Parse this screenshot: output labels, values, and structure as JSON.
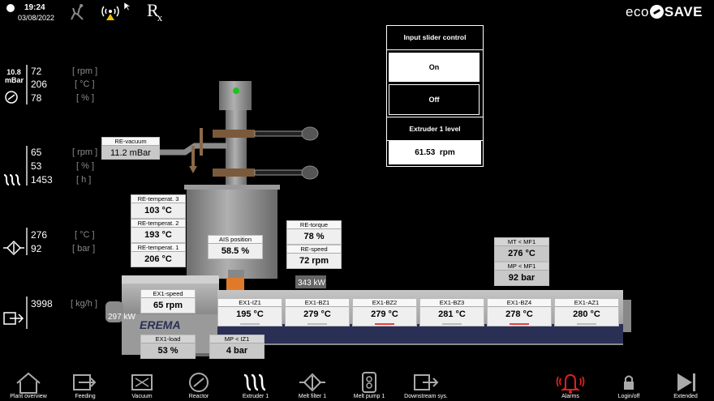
{
  "topbar": {
    "time": "19:24",
    "date": "03/08/2022",
    "brand": "ECO SAVE",
    "rx": "R"
  },
  "left_readouts": {
    "pressure": {
      "value": "10.8",
      "unit": "mBar"
    },
    "group1": [
      {
        "value": "72",
        "unit": "[ rpm ]"
      },
      {
        "value": "206",
        "unit": "[ °C ]"
      },
      {
        "value": "78",
        "unit": "[ % ]"
      }
    ],
    "group2": [
      {
        "value": "65",
        "unit": "[ rpm ]"
      },
      {
        "value": "53",
        "unit": "[ % ]"
      },
      {
        "value": "1453",
        "unit": "[ h ]"
      }
    ],
    "group3": [
      {
        "value": "276",
        "unit": "[ °C ]"
      },
      {
        "value": "92",
        "unit": "[ bar ]"
      }
    ],
    "group4": [
      {
        "value": "3998",
        "unit": "[ kg/h ]"
      }
    ]
  },
  "slider_panel": {
    "title": "Input slider control",
    "on_label": "On",
    "off_label": "Off",
    "level_title": "Extruder 1 level",
    "level_value": "61.53  rpm"
  },
  "process": {
    "re_vacuum": {
      "label": "RE-vacuum",
      "value": "11.2 mBar"
    },
    "re_temp3": {
      "label": "RE-temperat. 3",
      "value": "103 °C"
    },
    "re_temp2": {
      "label": "RE-temperat. 2",
      "value": "193 °C"
    },
    "re_temp1": {
      "label": "RE-temperat. 1",
      "value": "206 °C"
    },
    "ais_position": {
      "label": "AIS position",
      "value": "58.5 %"
    },
    "re_torque": {
      "label": "RE-torque",
      "value": "78 %"
    },
    "re_speed": {
      "label": "RE-speed",
      "value": "72 rpm"
    },
    "power_top": "343 kW",
    "power_left": "297 kW",
    "ex1_speed": {
      "label": "EX1-speed",
      "value": "65 rpm"
    },
    "ex1_load": {
      "label": "EX1-load",
      "value": "53 %"
    },
    "mp_iz1": {
      "label": "MP < IZ1",
      "value": "4 bar"
    },
    "mt_mf1": {
      "label": "MT < MF1",
      "value": "276 °C"
    },
    "mp_mf1": {
      "label": "MP < MF1",
      "value": "92 bar"
    },
    "brand": "EREMA",
    "zones": [
      {
        "label": "EX1-IZ1",
        "value": "195 °C",
        "bar_color": "#bbbbbb"
      },
      {
        "label": "EX1-BZ1",
        "value": "279 °C",
        "bar_color": "#bbbbbb"
      },
      {
        "label": "EX1-BZ2",
        "value": "279 °C",
        "bar_color": "#e04040"
      },
      {
        "label": "EX1-BZ3",
        "value": "281 °C",
        "bar_color": "#bbbbbb"
      },
      {
        "label": "EX1-BZ4",
        "value": "278 °C",
        "bar_color": "#e04040"
      },
      {
        "label": "EX1-AZ1",
        "value": "280 °C",
        "bar_color": "#bbbbbb"
      }
    ]
  },
  "nav": [
    {
      "label": "Plant overview",
      "icon": "home-icon"
    },
    {
      "label": "Feeding",
      "icon": "feeding-icon"
    },
    {
      "label": "Vacuum",
      "icon": "vacuum-icon"
    },
    {
      "label": "Reactor",
      "icon": "reactor-icon"
    },
    {
      "label": "Extruder 1",
      "icon": "extruder-icon"
    },
    {
      "label": "Melt filter 1",
      "icon": "melt-filter-icon"
    },
    {
      "label": "Melt pump 1",
      "icon": "melt-pump-icon"
    },
    {
      "label": "Downstream sys.",
      "icon": "downstream-icon"
    },
    {
      "label": "Alarms",
      "icon": "alarm-bell-icon"
    },
    {
      "label": "Login/off",
      "icon": "lock-icon"
    },
    {
      "label": "Extended",
      "icon": "extended-icon"
    }
  ],
  "colors": {
    "alarm": "#e02020",
    "accent_green": "#22c022",
    "screw_dark": "#2a2f55"
  }
}
